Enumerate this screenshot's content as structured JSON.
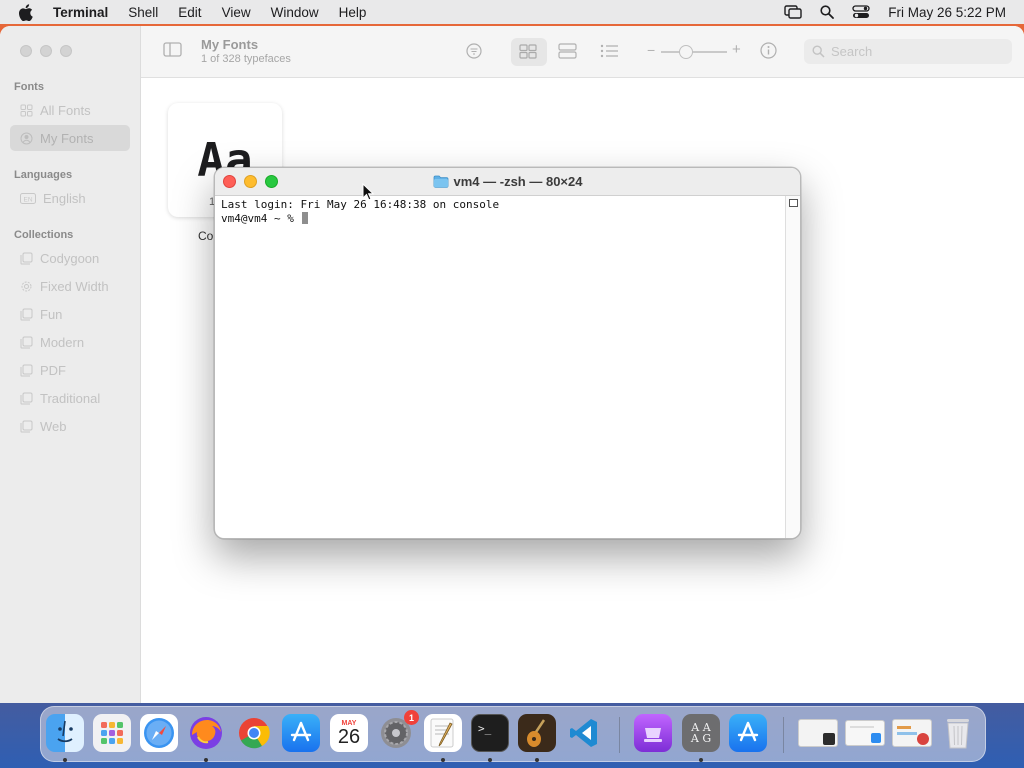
{
  "menubar": {
    "app": "Terminal",
    "items": [
      "Shell",
      "Edit",
      "View",
      "Window",
      "Help"
    ],
    "clock": "Fri May 26  5:22 PM"
  },
  "fontbook": {
    "title": "My Fonts",
    "subtitle": "1 of 328 typefaces",
    "search_placeholder": "Search",
    "sections": {
      "fonts": "Fonts",
      "languages": "Languages",
      "collections": "Collections"
    },
    "font_items": [
      "All Fonts",
      "My Fonts"
    ],
    "language_items": [
      "English"
    ],
    "collection_items": [
      "Codygoon",
      "Fixed Width",
      "Fun",
      "Modern",
      "PDF",
      "Traditional",
      "Web"
    ],
    "card_preview": "Aa",
    "card_label": "Co",
    "card_count": "1"
  },
  "terminal": {
    "title": "vm4 — -zsh — 80×24",
    "lines": [
      "Last login: Fri May 26 16:48:38 on console",
      "vm4@vm4 ~ % "
    ]
  },
  "dock": {
    "apps": [
      "Finder",
      "Launchpad",
      "Safari",
      "Firefox",
      "Chrome",
      "App Store",
      "Calendar",
      "System Preferences",
      "TextEdit",
      "Terminal",
      "Instruments",
      "Visual Studio Code",
      "Podcast",
      "Font Book",
      "App Store",
      "Downloads",
      "Documents",
      "Screenshots",
      "Trash"
    ],
    "calendar_month": "MAY",
    "calendar_day": "26",
    "settings_badge": "1"
  }
}
